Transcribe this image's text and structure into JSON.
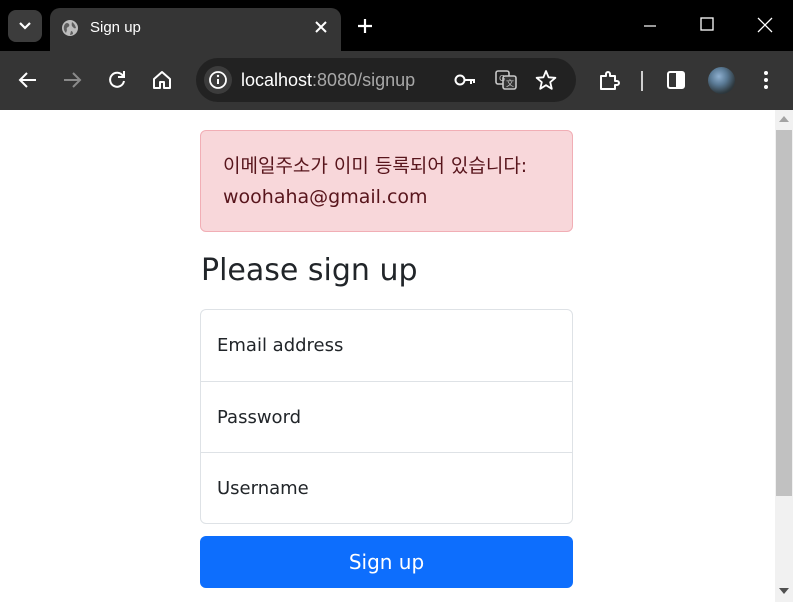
{
  "browser": {
    "tab_title": "Sign up",
    "url_host": "localhost",
    "url_rest": ":8080/signup"
  },
  "page": {
    "alert_text": "이메일주소가 이미 등록되어 있습니다: woohaha@gmail.com",
    "heading": "Please sign up",
    "fields": {
      "email_label": "Email address",
      "password_label": "Password",
      "username_label": "Username"
    },
    "submit_label": "Sign up"
  },
  "colors": {
    "alert_bg": "#f8d7da",
    "alert_text": "#58151c",
    "primary": "#0d6efd"
  },
  "icons": [
    "tab-search-icon",
    "globe-icon",
    "close-icon",
    "plus-icon",
    "minimize-icon",
    "maximize-icon",
    "back-icon",
    "forward-icon",
    "reload-icon",
    "home-icon",
    "site-info-icon",
    "key-icon",
    "translate-icon",
    "star-icon",
    "extensions-icon",
    "side-panel-icon",
    "profile-avatar",
    "menu-icon"
  ]
}
